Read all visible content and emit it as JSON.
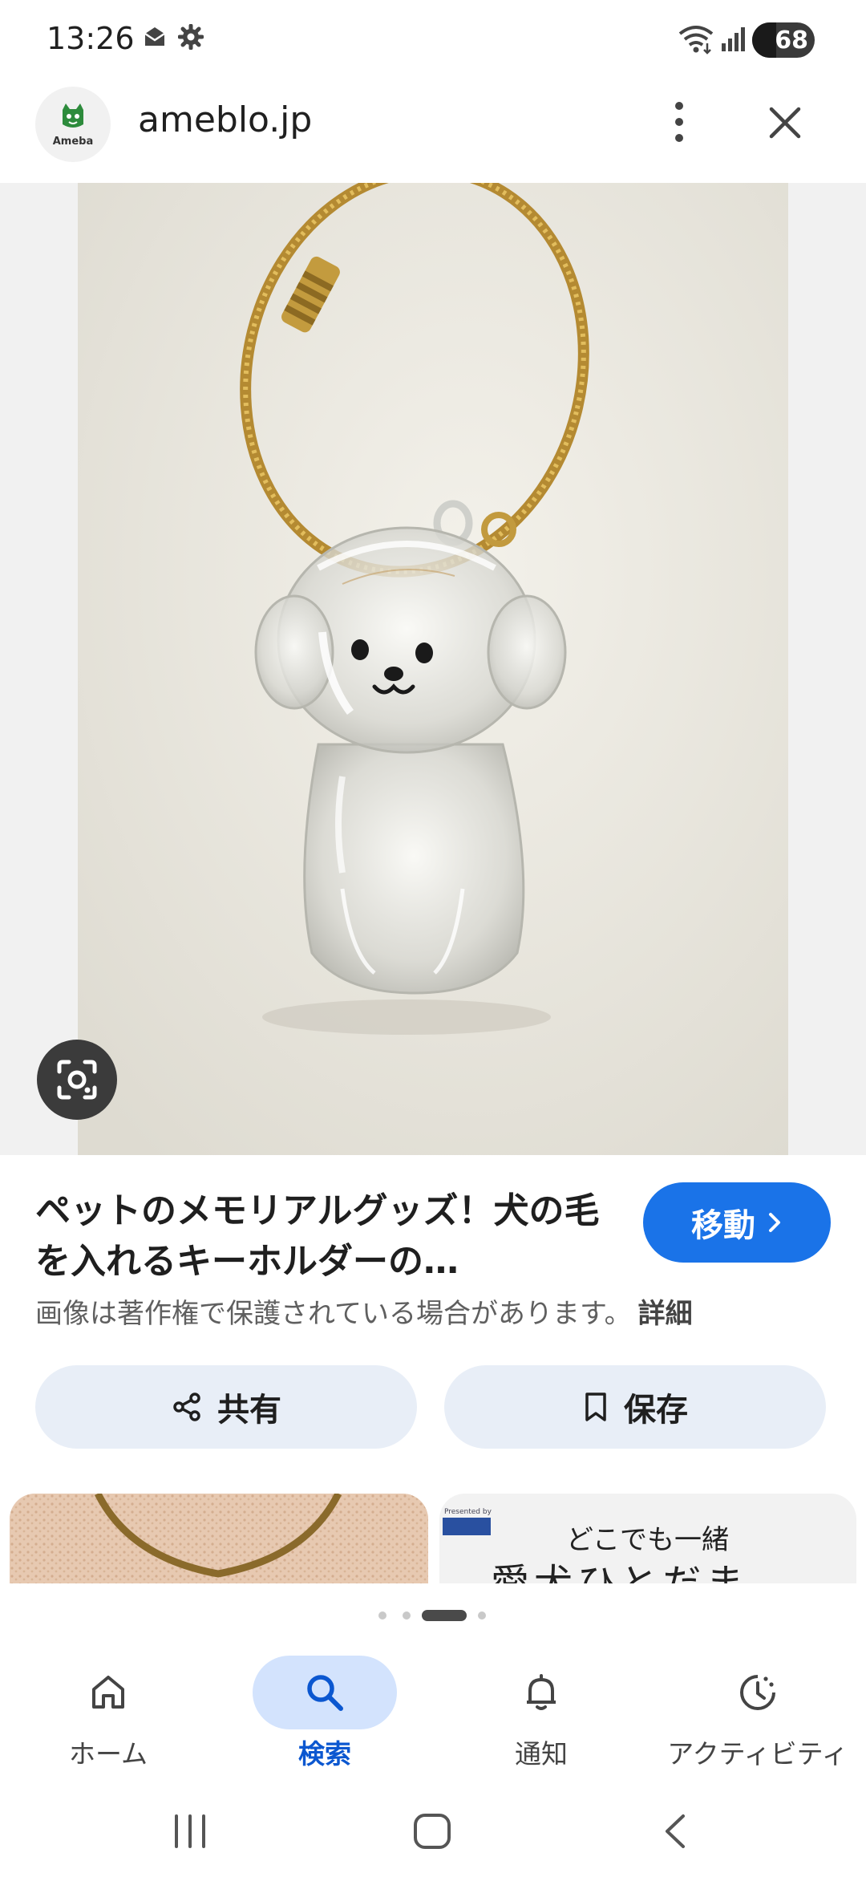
{
  "status_bar": {
    "time": "13:26",
    "battery": "68",
    "icons": [
      "mail-icon",
      "settings-icon",
      "wifi-icon",
      "signal-icon"
    ]
  },
  "header": {
    "avatar_brand": "Ameba",
    "site": "ameblo.jp"
  },
  "result": {
    "title": "ペットのメモリアルグッズ！犬の毛を入れるキーホルダーの…",
    "visit_label": "移動",
    "copyright_notice": "画像は著作権で保護されている場合があります。",
    "details_link": "詳細",
    "share_label": "共有",
    "save_label": "保存"
  },
  "related": {
    "thumb2_small": "Presented by",
    "thumb2_line1": "どこでも一緒",
    "thumb2_line2": "愛犬ひとだま"
  },
  "carousel": {
    "count": 4,
    "active": 2
  },
  "bottom_nav": [
    {
      "label": "ホーム",
      "icon": "home-icon",
      "active": false
    },
    {
      "label": "検索",
      "icon": "search-icon",
      "active": true
    },
    {
      "label": "通知",
      "icon": "bell-icon",
      "active": false
    },
    {
      "label": "アクティビティ",
      "icon": "activity-icon",
      "active": false
    }
  ],
  "colors": {
    "accent": "#1a73e8",
    "active_nav_bg": "#d3e3fd",
    "pill_bg": "#e8eef7"
  }
}
